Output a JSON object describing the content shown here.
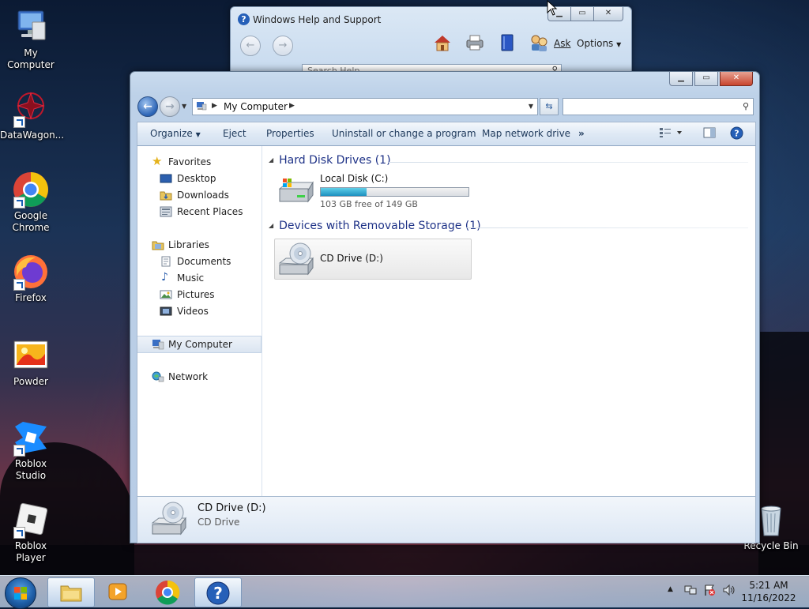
{
  "desktop": {
    "icons": [
      {
        "label": "My Computer"
      },
      {
        "label": "DataWagon..."
      },
      {
        "label": "Google Chrome"
      },
      {
        "label": "Firefox"
      },
      {
        "label": "Powder"
      },
      {
        "label": "Roblox Studio"
      },
      {
        "label": "Roblox Player"
      },
      {
        "label": "Recycle Bin"
      }
    ]
  },
  "help_window": {
    "title": "Windows Help and Support",
    "ask_label": "Ask",
    "options_label": "Options",
    "search_placeholder": "Search Help"
  },
  "explorer": {
    "address": {
      "location": "My Computer"
    },
    "search_placeholder": "",
    "commands": {
      "organize": "Organize",
      "eject": "Eject",
      "properties": "Properties",
      "uninstall": "Uninstall or change a program",
      "map_drive": "Map network drive",
      "more": "»"
    },
    "nav": {
      "favorites": "Favorites",
      "desktop": "Desktop",
      "downloads": "Downloads",
      "recent": "Recent Places",
      "libraries": "Libraries",
      "documents": "Documents",
      "music": "Music",
      "pictures": "Pictures",
      "videos": "Videos",
      "computer": "My Computer",
      "network": "Network"
    },
    "groups": {
      "hdd": "Hard Disk Drives (1)",
      "removable": "Devices with Removable Storage (1)"
    },
    "drives": {
      "c": {
        "name": "Local Disk (C:)",
        "free": "103 GB free of 149 GB",
        "used_fraction": 0.31
      },
      "d": {
        "name": "CD Drive (D:)"
      }
    },
    "details": {
      "name": "CD Drive (D:)",
      "type": "CD Drive"
    }
  },
  "taskbar": {
    "time": "5:21 AM",
    "date": "11/16/2022"
  },
  "colors": {
    "accent": "#1e3287",
    "progress": "#1c8fbf"
  }
}
